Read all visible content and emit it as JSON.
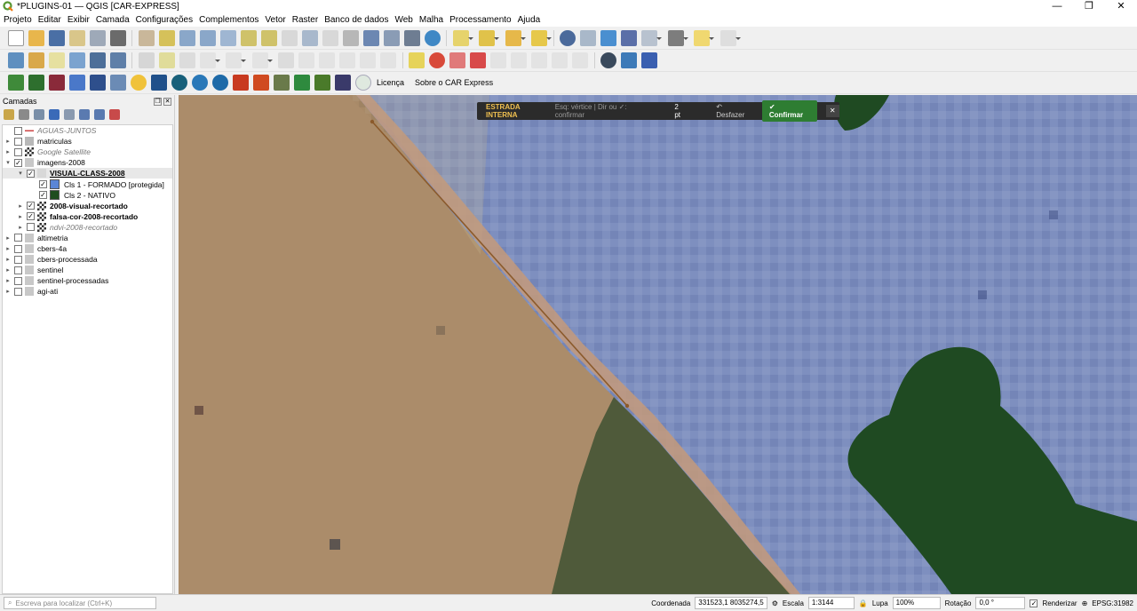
{
  "window": {
    "title": "*PLUGINS-01 — QGIS [CAR-EXPRESS]"
  },
  "menu": [
    "Projeto",
    "Editar",
    "Exibir",
    "Camada",
    "Configurações",
    "Complementos",
    "Vetor",
    "Raster",
    "Banco de dados",
    "Web",
    "Malha",
    "Processamento",
    "Ajuda"
  ],
  "toolbar3_links": {
    "license": "Licença",
    "about": "Sobre o CAR Express"
  },
  "layers_panel": {
    "title": "Camadas",
    "layers": [
      {
        "label": "AGUAS-JUNTOS",
        "indent": 0,
        "arrow": "",
        "checked": false,
        "style": "it",
        "icon": "line"
      },
      {
        "label": "matriculas",
        "indent": 0,
        "arrow": "▸",
        "checked": false,
        "style": "",
        "icon": "vector"
      },
      {
        "label": "Google Satellite",
        "indent": 0,
        "arrow": "▸",
        "checked": false,
        "style": "it",
        "icon": "raster"
      },
      {
        "label": "imagens-2008",
        "indent": 0,
        "arrow": "▾",
        "checked": true,
        "style": "",
        "icon": "group"
      },
      {
        "label": "VISUAL-CLASS-2008",
        "indent": 1,
        "arrow": "▾",
        "checked": true,
        "style": "bold under",
        "icon": "poly"
      },
      {
        "label": "Cls 1 - FORMADO [protegida]",
        "indent": 2,
        "arrow": "",
        "checked": true,
        "style": "",
        "icon": "swatch",
        "color": "#5b86d6"
      },
      {
        "label": "Cls 2 - NATIVO",
        "indent": 2,
        "arrow": "",
        "checked": true,
        "style": "",
        "icon": "swatch",
        "color": "#1f4d1f"
      },
      {
        "label": "2008-visual-recortado",
        "indent": 1,
        "arrow": "▸",
        "checked": true,
        "style": "bold",
        "icon": "raster"
      },
      {
        "label": "falsa-cor-2008-recortado",
        "indent": 1,
        "arrow": "▸",
        "checked": true,
        "style": "bold",
        "icon": "raster"
      },
      {
        "label": "ndvi-2008-recortado",
        "indent": 1,
        "arrow": "▸",
        "checked": false,
        "style": "it",
        "icon": "raster"
      },
      {
        "label": "altimetria",
        "indent": 0,
        "arrow": "▸",
        "checked": false,
        "style": "",
        "icon": "group"
      },
      {
        "label": "cbers-4a",
        "indent": 0,
        "arrow": "▸",
        "checked": false,
        "style": "",
        "icon": "group"
      },
      {
        "label": "cbers-processada",
        "indent": 0,
        "arrow": "▸",
        "checked": false,
        "style": "",
        "icon": "group"
      },
      {
        "label": "sentinel",
        "indent": 0,
        "arrow": "▸",
        "checked": false,
        "style": "",
        "icon": "group"
      },
      {
        "label": "sentinel-processadas",
        "indent": 0,
        "arrow": "▸",
        "checked": false,
        "style": "",
        "icon": "group"
      },
      {
        "label": "agi-ati",
        "indent": 0,
        "arrow": "▸",
        "checked": false,
        "style": "",
        "icon": "group"
      }
    ]
  },
  "digitize_bar": {
    "title": "ESTRADA INTERNA",
    "hint": "Esq: vértice | Dir ou ✓: confirmar",
    "points": "2 pt",
    "undo": "↶ Desfazer",
    "confirm": "✔ Confirmar",
    "close": "✕"
  },
  "status": {
    "locator_placeholder": "Escreva para localizar (Ctrl+K)",
    "coord_label": "Coordenada",
    "coord": "331523,1  8035274,5",
    "scale_label": "Escala",
    "scale": "1:3144",
    "magnifier_label": "Lupa",
    "magnifier": "100%",
    "rotation_label": "Rotação",
    "rotation": "0,0 °",
    "render_label": "Renderizar",
    "crs": "EPSG:31982"
  }
}
